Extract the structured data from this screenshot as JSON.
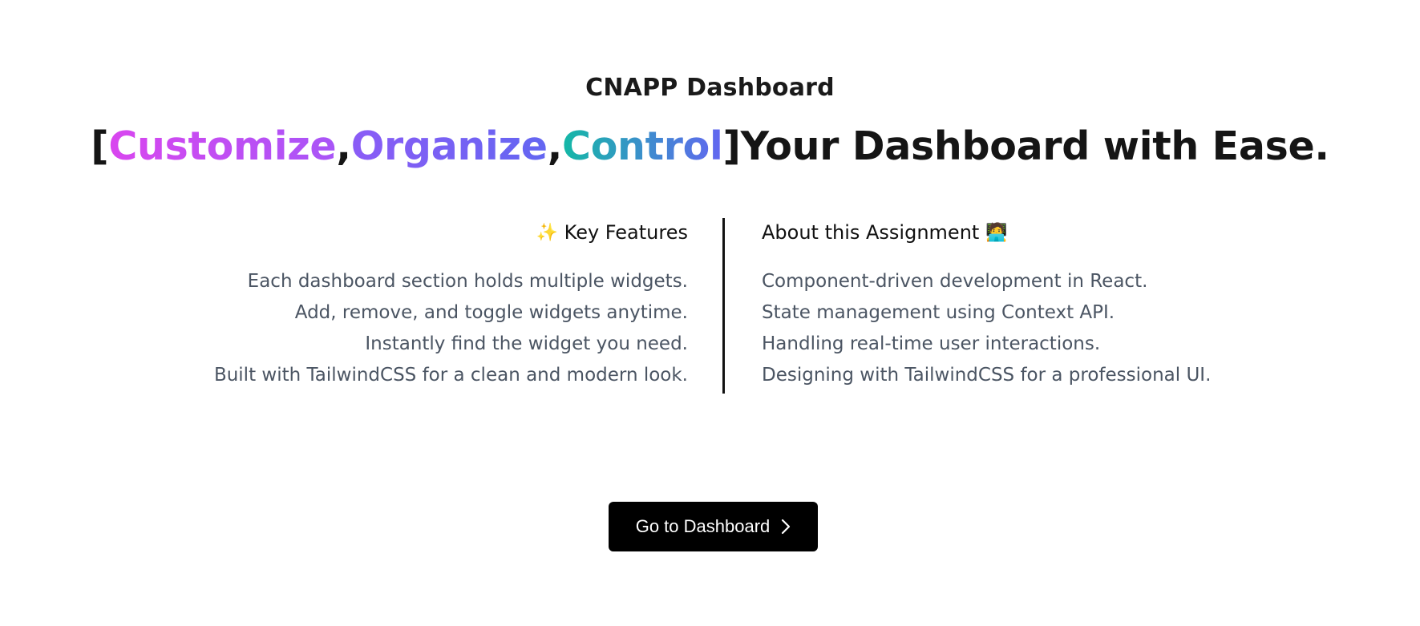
{
  "app_title": "CNAPP Dashboard",
  "headline": {
    "bracket_open": "[",
    "word1": "Customize",
    "comma1": ",",
    "word2": "Organize",
    "comma2": ",",
    "word3": "Control",
    "bracket_close": "]",
    "rest": "Your Dashboard with Ease."
  },
  "key_features": {
    "icon": "✨",
    "title": "Key Features",
    "items": [
      "Each dashboard section holds multiple widgets.",
      "Add, remove, and toggle widgets anytime.",
      "Instantly find the widget you need.",
      "Built with TailwindCSS for a clean and modern look."
    ]
  },
  "about": {
    "title": "About this Assignment",
    "icon": "🧑‍💻",
    "items": [
      "Component-driven development in React.",
      "State management using Context API.",
      "Handling real-time user interactions.",
      "Designing with TailwindCSS for a professional UI."
    ]
  },
  "cta": {
    "label": "Go to Dashboard",
    "icon": "chevron-right-icon"
  },
  "colors": {
    "cta_bg": "#000000",
    "text_primary": "#111111",
    "text_secondary": "#4b5563",
    "gradient_customize": [
      "#d946ef",
      "#a855f7"
    ],
    "gradient_organize": [
      "#8b5cf6",
      "#6366f1"
    ],
    "gradient_control": [
      "#14b8a6",
      "#6366f1"
    ]
  }
}
